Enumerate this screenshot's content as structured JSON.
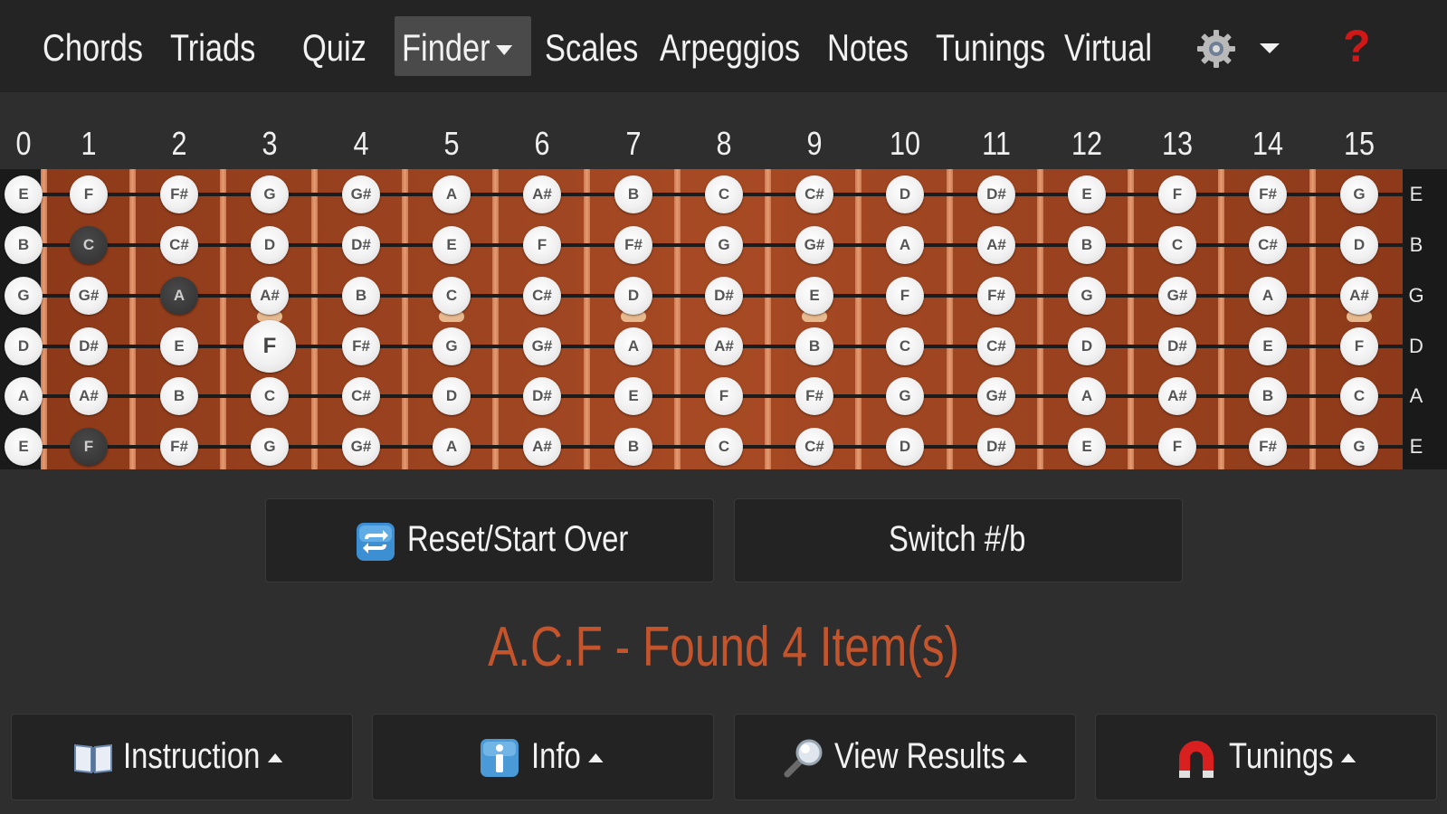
{
  "nav": {
    "items": [
      "Chords",
      "Triads",
      "Quiz",
      "Finder",
      "Scales",
      "Arpeggios",
      "Notes",
      "Tunings",
      "Virtual"
    ],
    "help": "?"
  },
  "fretboard": {
    "fret_numbers": [
      "0",
      "1",
      "2",
      "3",
      "4",
      "5",
      "6",
      "7",
      "8",
      "9",
      "10",
      "11",
      "12",
      "13",
      "14",
      "15"
    ],
    "string_labels": [
      "E",
      "B",
      "G",
      "D",
      "A",
      "E"
    ],
    "strings": [
      [
        "E",
        "F",
        "F#",
        "G",
        "G#",
        "A",
        "A#",
        "B",
        "C",
        "C#",
        "D",
        "D#",
        "E",
        "F",
        "F#",
        "G"
      ],
      [
        "B",
        "C",
        "C#",
        "D",
        "D#",
        "E",
        "F",
        "F#",
        "G",
        "G#",
        "A",
        "A#",
        "B",
        "C",
        "C#",
        "D"
      ],
      [
        "G",
        "G#",
        "A",
        "A#",
        "B",
        "C",
        "C#",
        "D",
        "D#",
        "E",
        "F",
        "F#",
        "G",
        "G#",
        "A",
        "A#"
      ],
      [
        "D",
        "D#",
        "E",
        "F",
        "F#",
        "G",
        "G#",
        "A",
        "A#",
        "B",
        "C",
        "C#",
        "D",
        "D#",
        "E",
        "F"
      ],
      [
        "A",
        "A#",
        "B",
        "C",
        "C#",
        "D",
        "D#",
        "E",
        "F",
        "F#",
        "G",
        "G#",
        "A",
        "A#",
        "B",
        "C"
      ],
      [
        "E",
        "F",
        "F#",
        "G",
        "G#",
        "A",
        "A#",
        "B",
        "C",
        "C#",
        "D",
        "D#",
        "E",
        "F",
        "F#",
        "G"
      ]
    ],
    "selected": [
      [
        1,
        1
      ],
      [
        2,
        2
      ],
      [
        5,
        1
      ]
    ],
    "highlighted": [
      [
        3,
        3
      ]
    ],
    "colors": {
      "wood": "#a74a24",
      "fret": "#e89a70",
      "selected_note": "#2f2f2f"
    }
  },
  "buttons": {
    "reset": "Reset/Start Over",
    "switch": "Switch #/b"
  },
  "result": {
    "text": "A.C.F - Found 4 Item(s)",
    "color": "#c4542c"
  },
  "panels": {
    "instruction": "Instruction",
    "info": "Info",
    "view_results": "View Results",
    "tunings": "Tunings"
  }
}
